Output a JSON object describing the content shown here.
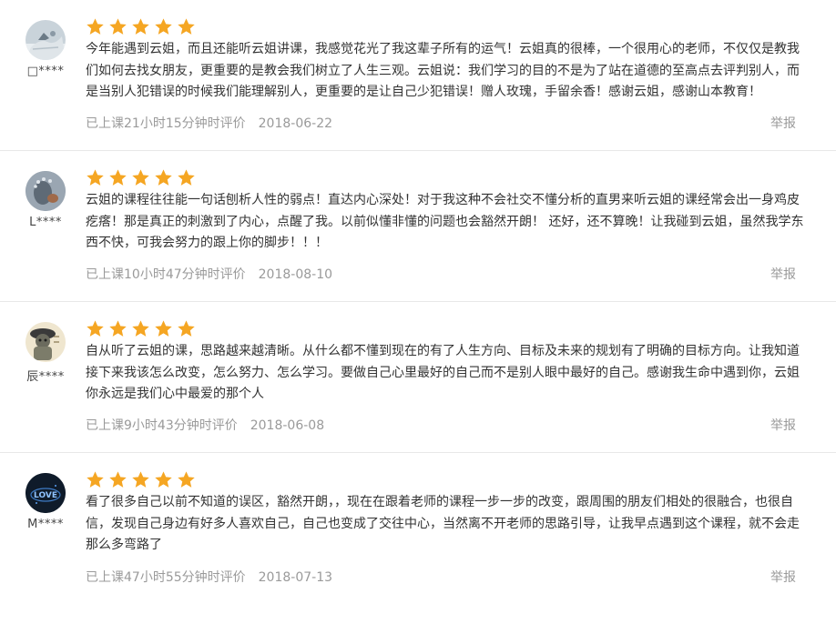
{
  "accent_star_color": "#f5a623",
  "star_icon": "star-icon",
  "reviews": [
    {
      "user": "\u0000****",
      "user_display": "□****",
      "rating": 5,
      "text": "今年能遇到云姐，而且还能听云姐讲课，我感觉花光了我这辈子所有的运气！云姐真的很棒，一个很用心的老师，不仅仅是教我们如何去找女朋友，更重要的是教会我们树立了人生三观。云姐说：我们学习的目的不是为了站在道德的至高点去评判别人，而是当别人犯错误的时候我们能理解别人，更重要的是让自己少犯错误！赠人玫瑰，手留余香！感谢云姐，感谢山本教育！",
      "study_time": "已上课21小时15分钟时评价",
      "date": "2018-06-22",
      "report": "举报"
    },
    {
      "user_display": "L****",
      "rating": 5,
      "text": "云姐的课程往往能一句话刨析人性的弱点！直达内心深处！对于我这种不会社交不懂分析的直男来听云姐的课经常会出一身鸡皮疙瘩！那是真正的刺激到了内心，点醒了我。以前似懂非懂的问题也会豁然开朗！ 还好，还不算晚！让我碰到云姐，虽然我学东西不快，可我会努力的跟上你的脚步！！！",
      "study_time": "已上课10小时47分钟时评价",
      "date": "2018-08-10",
      "report": "举报"
    },
    {
      "user_display": "辰****",
      "rating": 5,
      "text": "自从听了云姐的课，思路越来越清晰。从什么都不懂到现在的有了人生方向、目标及未来的规划有了明确的目标方向。让我知道接下来我该怎么改变，怎么努力、怎么学习。要做自己心里最好的自己而不是别人眼中最好的自己。感谢我生命中遇到你，云姐你永远是我们心中最爱的那个人",
      "study_time": "已上课9小时43分钟时评价",
      "date": "2018-06-08",
      "report": "举报"
    },
    {
      "user_display": "M****",
      "rating": 5,
      "text": "看了很多自己以前不知道的误区，豁然开朗，，现在在跟着老师的课程一步一步的改变，跟周围的朋友们相处的很融合，也很自信，发现自己身边有好多人喜欢自己，自己也变成了交往中心，当然离不开老师的思路引导，让我早点遇到这个课程，就不会走那么多弯路了",
      "study_time": "已上课47小时55分钟时评价",
      "date": "2018-07-13",
      "report": "举报"
    }
  ]
}
